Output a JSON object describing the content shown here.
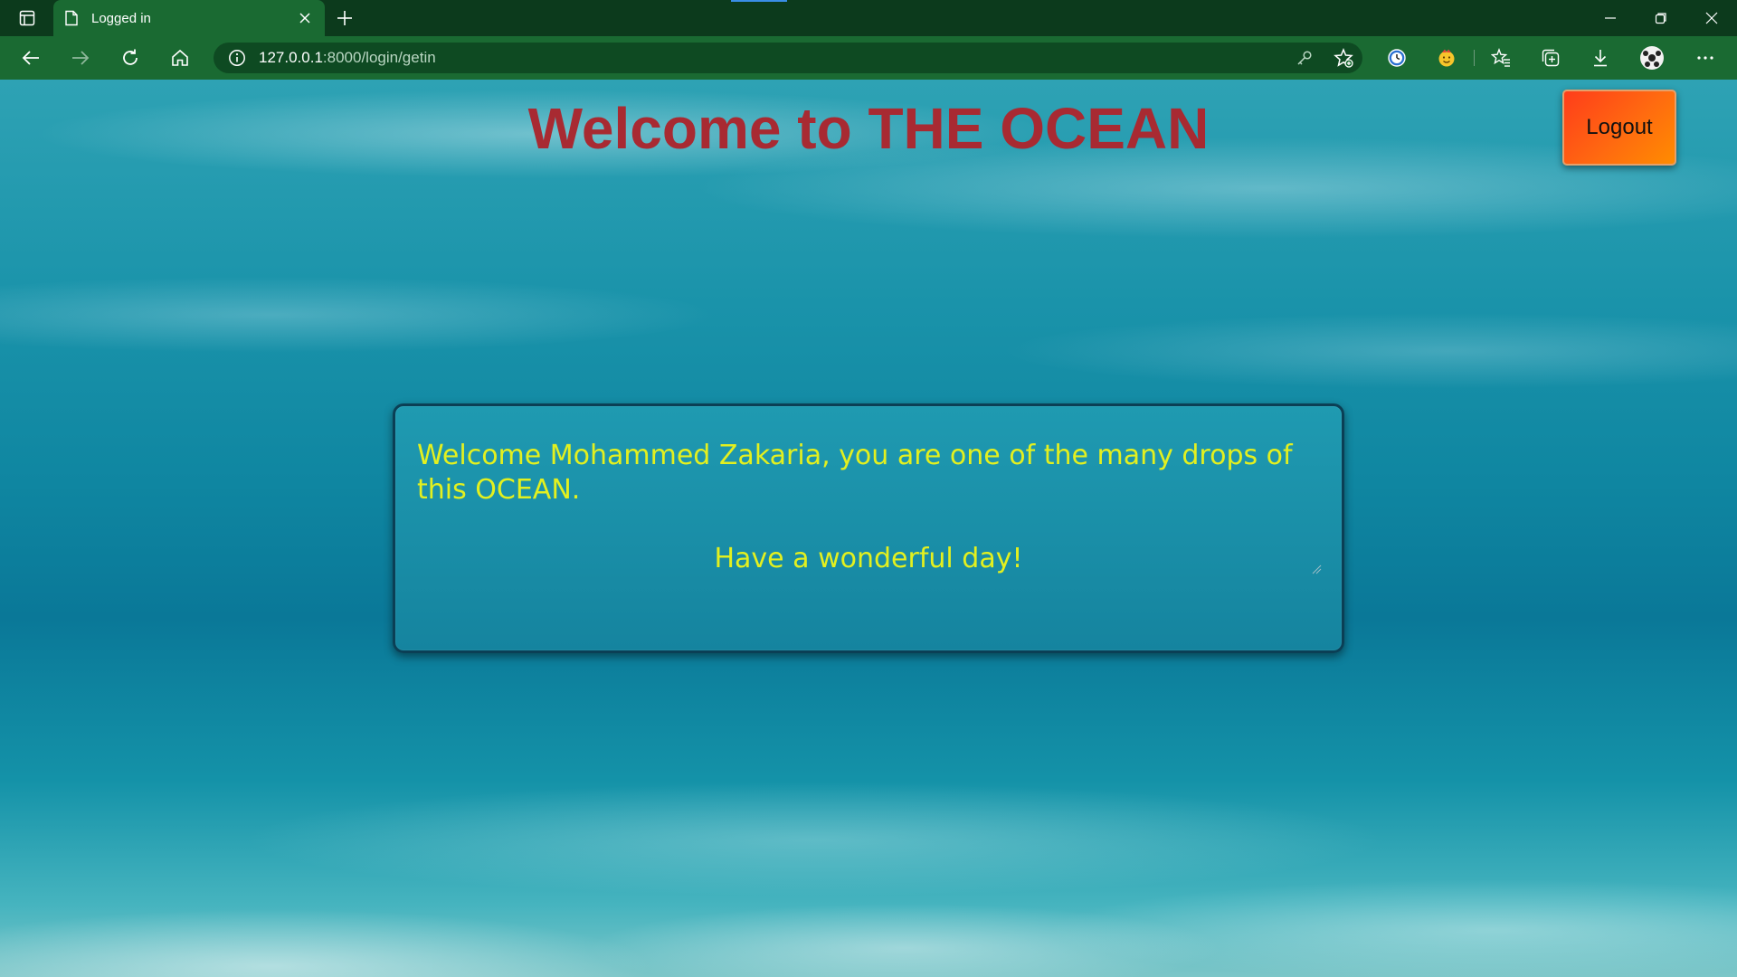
{
  "browser": {
    "tab": {
      "title": "Logged in",
      "close_icon": "close-icon",
      "page_icon": "page-icon"
    },
    "new_tab_icon": "plus-icon",
    "address_bar": {
      "host": "127.0.0.1",
      "path": ":8000/login/getin",
      "info_icon": "info-icon"
    },
    "window_controls": [
      "minimize-icon",
      "restore-icon",
      "close-icon"
    ],
    "theme_colors": {
      "tabstrip": "#0c3a1c",
      "toolbar": "#1a6a32",
      "addressbar": "#0e4a22"
    }
  },
  "page": {
    "title": "Welcome to THE OCEAN",
    "logout_label": "Logout",
    "message": {
      "line1": "Welcome Mohammed Zakaria, you are one of the many drops of this OCEAN.",
      "line2": "Have a wonderful day!"
    },
    "colors": {
      "title": "#a82a32",
      "message_text": "#e3f01f",
      "logout_bg": "#ff5a14"
    }
  }
}
